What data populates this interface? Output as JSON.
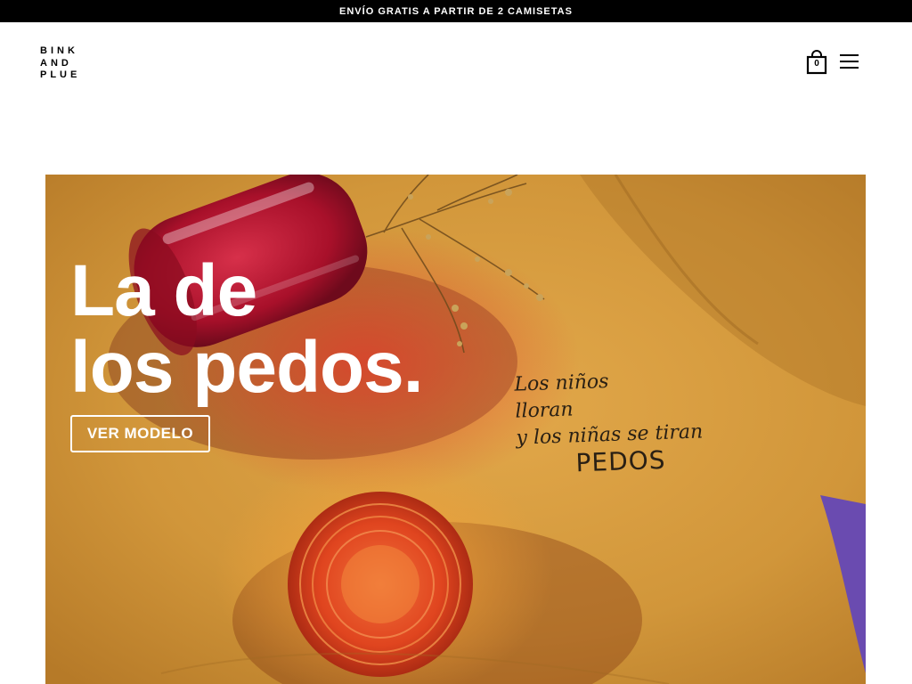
{
  "announcement": {
    "text": "ENVÍO GRATIS A PARTIR DE 2 CAMISETAS"
  },
  "header": {
    "logo_lines": [
      "BINK",
      "AND",
      "PLUE"
    ],
    "cart_count": "0",
    "cart_icon": "shopping-bag-icon",
    "menu_icon": "hamburger-menu-icon"
  },
  "hero": {
    "title_line1": "La de",
    "title_line2": "los pedos.",
    "cta_label": "VER MODELO",
    "shirt_print_lines": [
      "Los niños",
      "lloran",
      "y los niñas se tiran",
      "PEDOS"
    ]
  },
  "colors": {
    "announcement_bg": "#000000",
    "shirt_mustard": "#d39a3a",
    "glass_red": "#b8152a",
    "glass_orange": "#e0451f",
    "accent_purple": "#6a4bb0"
  }
}
